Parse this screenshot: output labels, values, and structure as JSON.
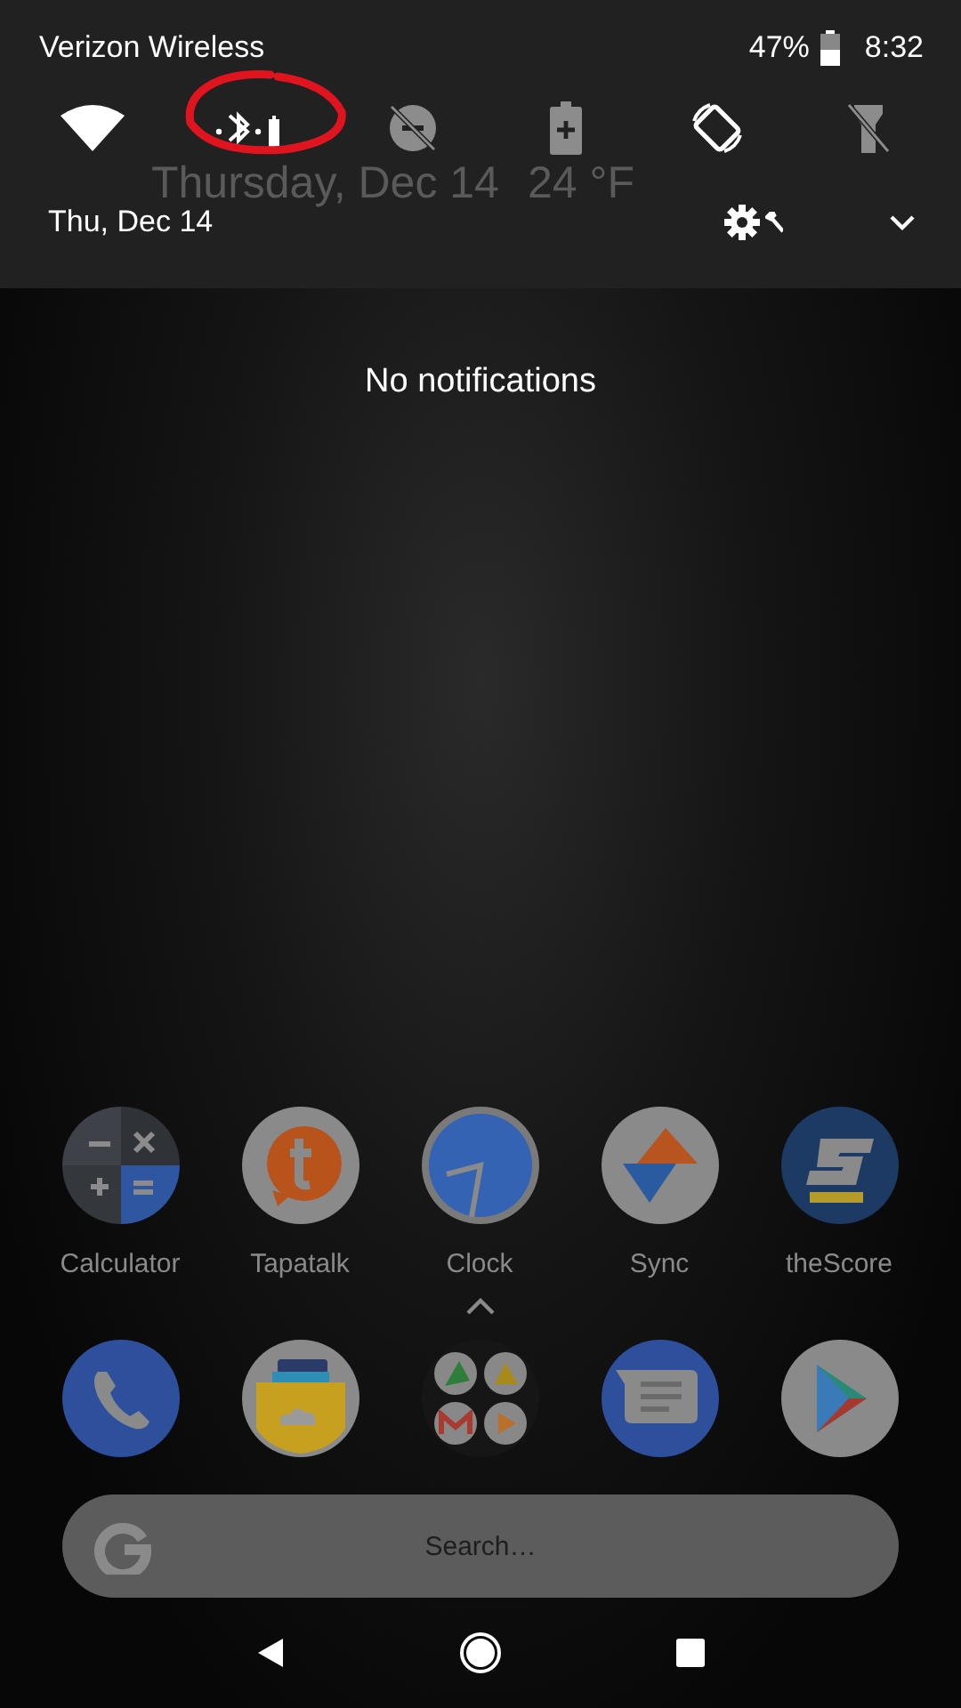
{
  "status_bar": {
    "carrier": "Verizon Wireless",
    "battery": "47%",
    "time": "8:32"
  },
  "quick_settings": [
    {
      "on": true
    },
    {
      "on": true
    },
    {
      "on": false
    },
    {
      "on": false
    },
    {
      "on": true
    },
    {
      "on": false
    }
  ],
  "shade_date": "Thu, Dec 14",
  "background_widget": {
    "date": "Thursday, Dec 14",
    "weather": "24 °F"
  },
  "notifications_message": "No notifications",
  "apps": [
    {
      "label": "Calculator"
    },
    {
      "label": "Tapatalk"
    },
    {
      "label": "Clock"
    },
    {
      "label": "Sync"
    },
    {
      "label": "theScore"
    }
  ],
  "search": {
    "placeholder": "Search…"
  },
  "annotations": [
    {
      "kind": "circle",
      "color": "#e0141e"
    }
  ]
}
